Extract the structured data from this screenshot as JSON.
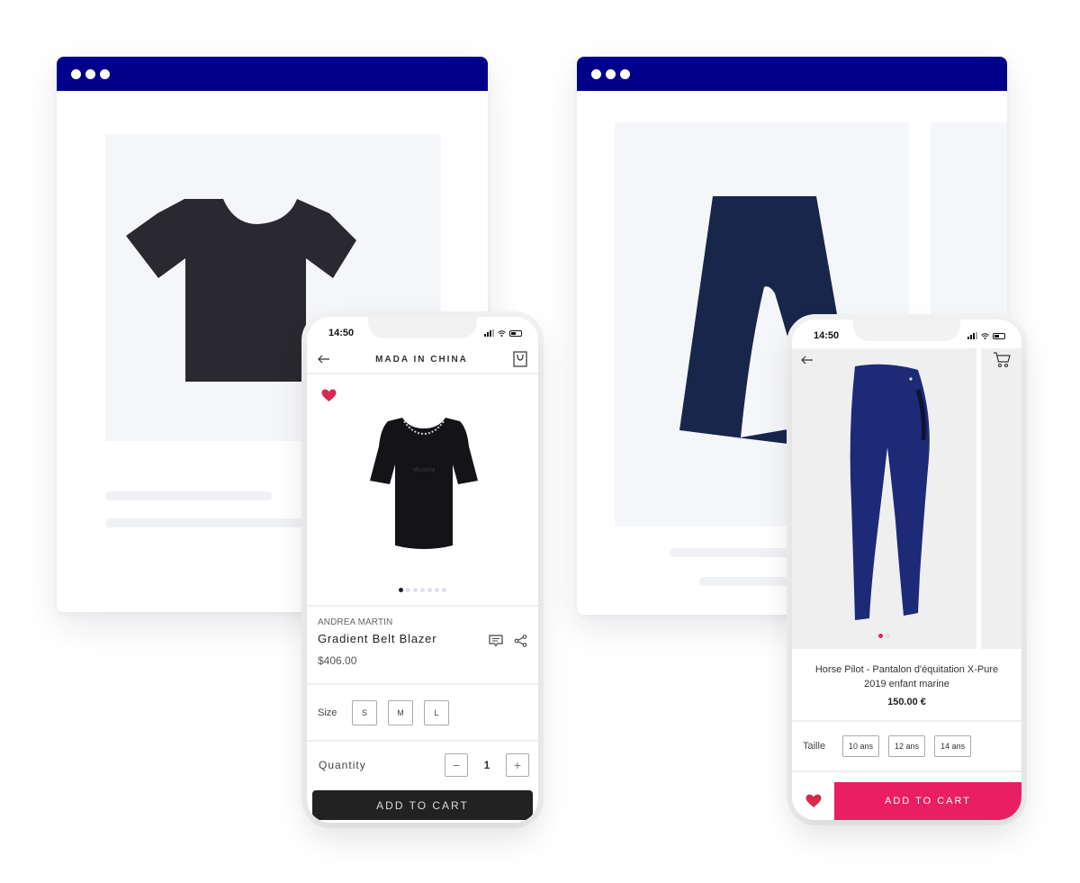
{
  "colors": {
    "browser_titlebar": "#00008b",
    "heart": "#d62b4f",
    "accent_pink": "#e91e63",
    "dark_button": "#222222",
    "tshirt_silhouette": "#2b2930",
    "pants_silhouette": "#18264b"
  },
  "browser_left": {
    "window_dots": 3,
    "illustration_icon": "tshirt-icon"
  },
  "browser_right": {
    "window_dots": 3,
    "illustration_icon": "pants-icon"
  },
  "phone_left": {
    "status": {
      "time": "14:50"
    },
    "header": {
      "back_icon": "arrow-left-icon",
      "title": "MADA IN CHINA",
      "bag_icon": "shopping-bag-icon"
    },
    "gallery": {
      "favorite_icon": "heart-icon",
      "image_watermark": "Viconia",
      "slide_count": 7,
      "active_slide": 1
    },
    "product": {
      "brand": "ANDREA MARTIN",
      "name": "Gradient Belt Blazer",
      "price": "$406.00",
      "actions": [
        "comment-icon",
        "share-icon"
      ]
    },
    "size": {
      "label": "Size",
      "options": [
        "S",
        "M",
        "L"
      ]
    },
    "quantity": {
      "label": "Quantity",
      "value": "1",
      "decrement": "−",
      "increment": "+"
    },
    "add_to_cart": "ADD TO CART"
  },
  "phone_right": {
    "status": {
      "time": "14:50"
    },
    "header": {
      "back_icon": "arrow-left-icon",
      "cart_icon": "shopping-cart-icon"
    },
    "gallery": {
      "slide_count": 2,
      "active_slide": 1
    },
    "product": {
      "name_line1": "Horse Pilot - Pantalon d'équitation X-Pure",
      "name_line2": "2019 enfant marine",
      "price": "150.00 €"
    },
    "taille": {
      "label": "Taille",
      "options": [
        "10 ans",
        "12 ans",
        "14 ans"
      ]
    },
    "favorite_icon": "heart-icon",
    "add_to_cart": "ADD TO CART"
  }
}
